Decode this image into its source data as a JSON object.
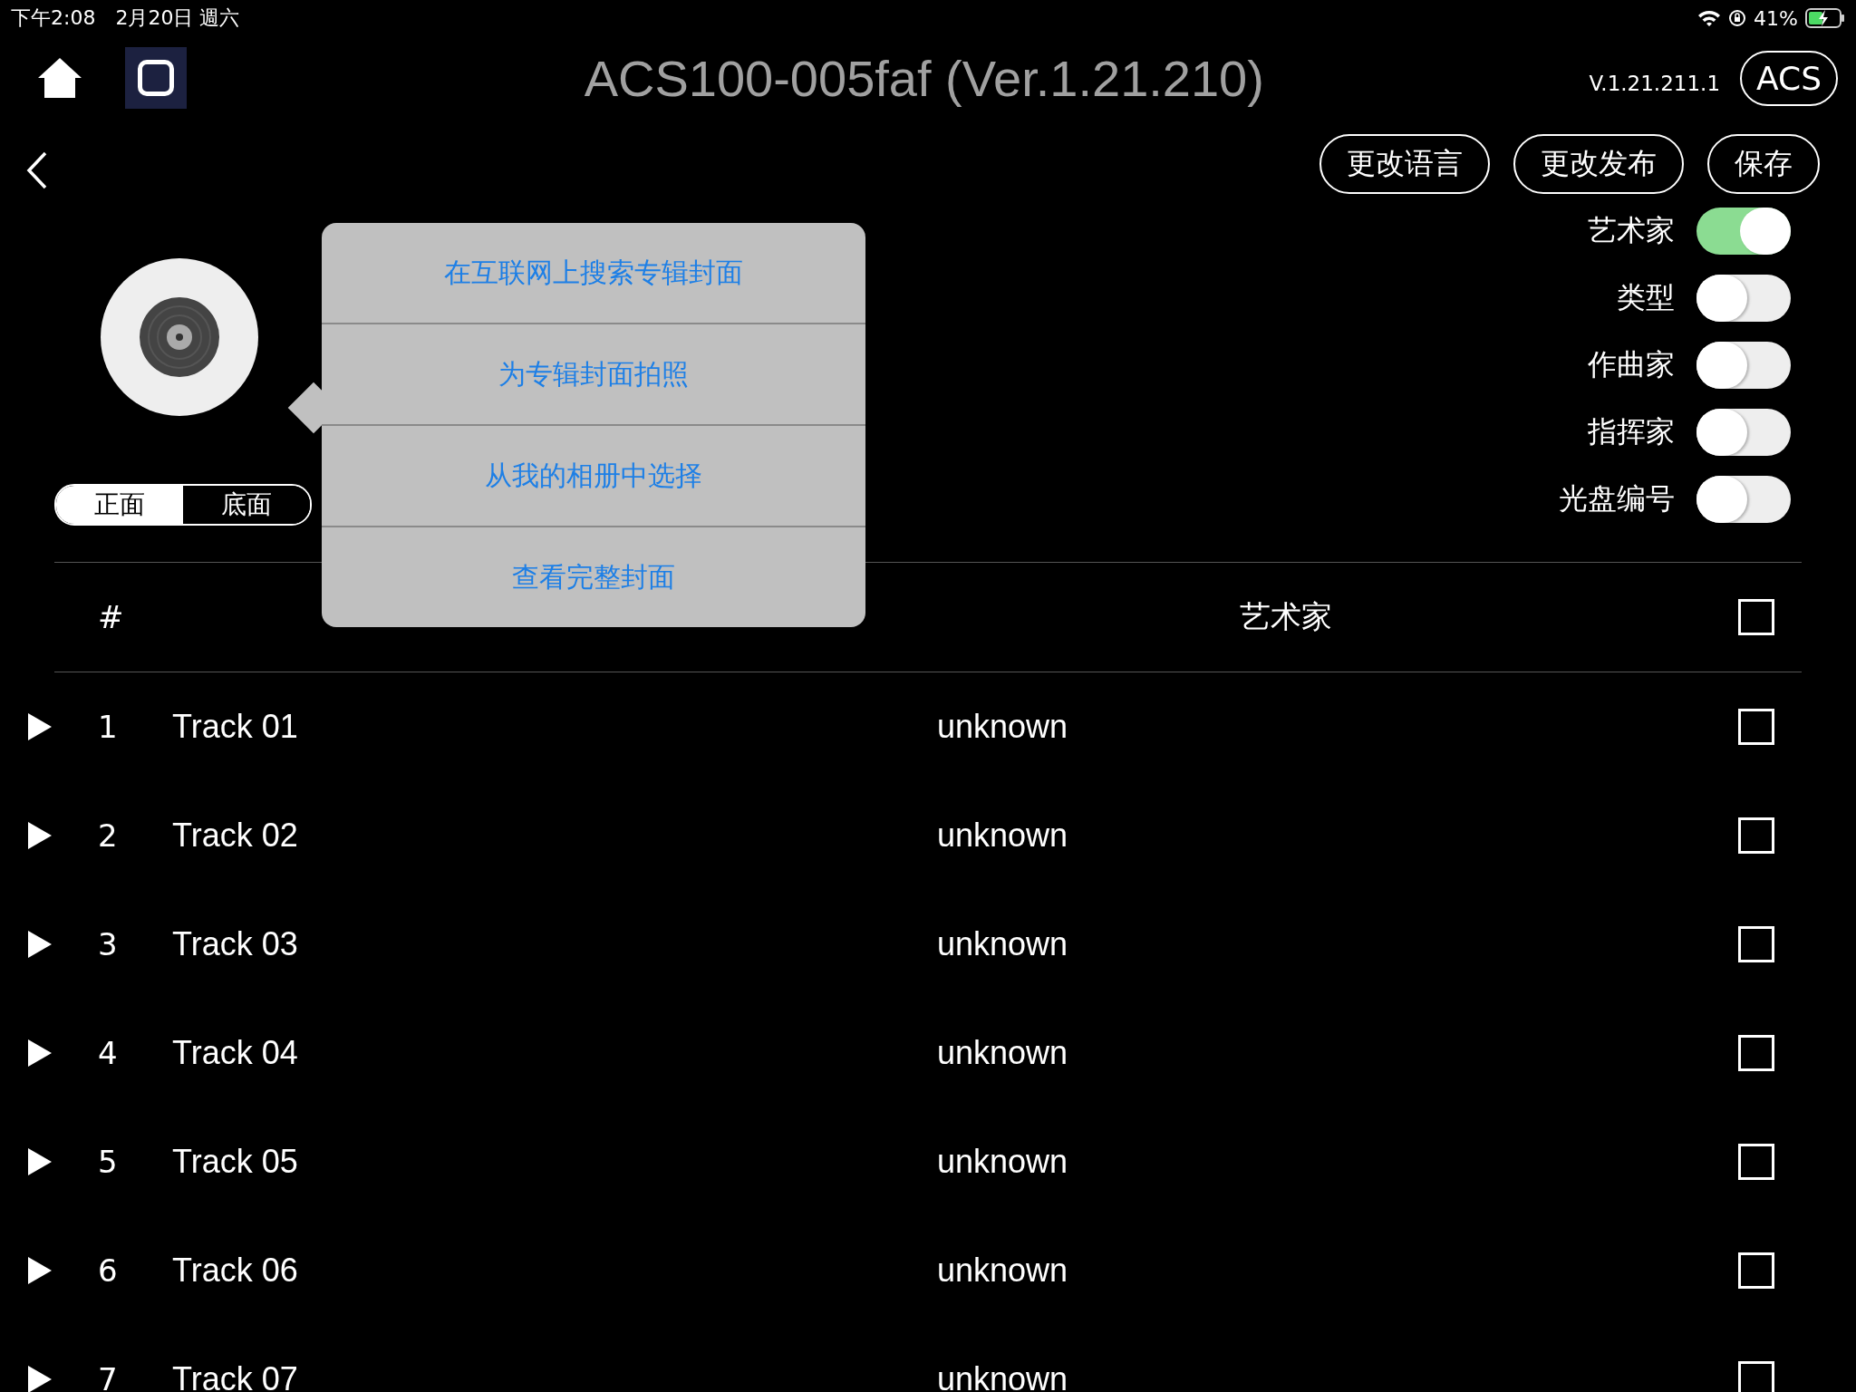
{
  "status_bar": {
    "time": "下午2:08",
    "date": "2月20日 週六",
    "battery": "41%"
  },
  "header": {
    "title": "ACS100-005faf (Ver.1.21.210)",
    "version": "V.1.21.211.1",
    "badge": "ACS"
  },
  "actions": [
    "更改语言",
    "更改发布",
    "保存"
  ],
  "cover_side": [
    {
      "label": "正面",
      "selected": true
    },
    {
      "label": "底面",
      "selected": false
    }
  ],
  "toggles": [
    {
      "label": "艺术家",
      "on": true
    },
    {
      "label": "类型",
      "on": false
    },
    {
      "label": "作曲家",
      "on": false
    },
    {
      "label": "指挥家",
      "on": false
    },
    {
      "label": "光盘编号",
      "on": false
    }
  ],
  "table": {
    "columns": [
      "#",
      "艺术家"
    ],
    "header_checked": false,
    "rows": [
      {
        "number": "1",
        "title": "Track 01",
        "artist": "unknown",
        "checked": false
      },
      {
        "number": "2",
        "title": "Track 02",
        "artist": "unknown",
        "checked": false
      },
      {
        "number": "3",
        "title": "Track 03",
        "artist": "unknown",
        "checked": false
      },
      {
        "number": "4",
        "title": "Track 04",
        "artist": "unknown",
        "checked": false
      },
      {
        "number": "5",
        "title": "Track 05",
        "artist": "unknown",
        "checked": false
      },
      {
        "number": "6",
        "title": "Track 06",
        "artist": "unknown",
        "checked": false
      },
      {
        "number": "7",
        "title": "Track 07",
        "artist": "unknown",
        "checked": false
      }
    ]
  },
  "popover": {
    "items": [
      "在互联网上搜索专辑封面",
      "为专辑封面拍照",
      "从我的相册中选择",
      "查看完整封面"
    ]
  }
}
